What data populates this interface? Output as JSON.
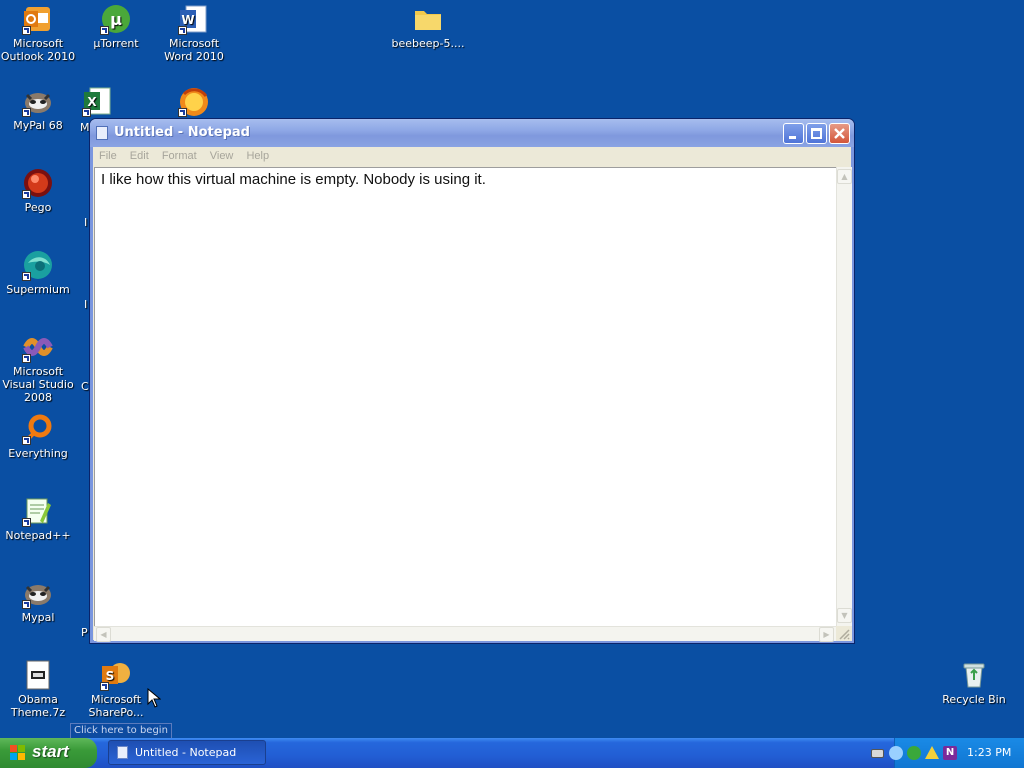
{
  "desktop": {
    "icons": [
      {
        "label": "Microsoft Outlook 2010",
        "icon": "outlook-icon"
      },
      {
        "label": "µTorrent",
        "icon": "utorrent-icon"
      },
      {
        "label": "Microsoft Word 2010",
        "icon": "word-icon"
      },
      {
        "label": "beebeep-5....",
        "icon": "folder-icon"
      },
      {
        "label": "MyPal 68",
        "icon": "mypal-icon"
      },
      {
        "label": "M",
        "icon": "excel-icon"
      },
      {
        "label": "",
        "icon": "firefox-icon"
      },
      {
        "label": "Pego",
        "icon": "pego-icon"
      },
      {
        "label": "Supermium",
        "icon": "supermium-icon"
      },
      {
        "label": "Microsoft Visual Studio 2008",
        "icon": "visual-studio-icon"
      },
      {
        "label": "Everything",
        "icon": "everything-icon"
      },
      {
        "label": "Notepad++",
        "icon": "notepadpp-icon"
      },
      {
        "label": "Mypal",
        "icon": "mypal-icon"
      },
      {
        "label": "Obama Theme.7z",
        "icon": "archive-icon"
      },
      {
        "label": "Microsoft SharePo...",
        "icon": "sharepoint-icon"
      },
      {
        "label": "Recycle Bin",
        "icon": "recycle-bin-icon"
      }
    ],
    "edge_letters": [
      "I",
      "I",
      "C",
      "P"
    ]
  },
  "notepad": {
    "title": "Untitled - Notepad",
    "menu": [
      "File",
      "Edit",
      "Format",
      "View",
      "Help"
    ],
    "content": "I like how this virtual machine is empty. Nobody is using it."
  },
  "tooltip": "Click here to begin",
  "taskbar": {
    "start_label": "start",
    "task_label": "Untitled - Notepad",
    "clock": "1:23 PM",
    "tray_icons": [
      "keyboard-icon",
      "network-icon",
      "utorrent-tray-icon",
      "warning-icon",
      "onenote-icon"
    ]
  },
  "colors": {
    "desktop": "#0a4fa3",
    "taskbar": "#225ed4",
    "start_button": "#3a9b39",
    "title_bar_inactive": "#8fa8e6"
  }
}
